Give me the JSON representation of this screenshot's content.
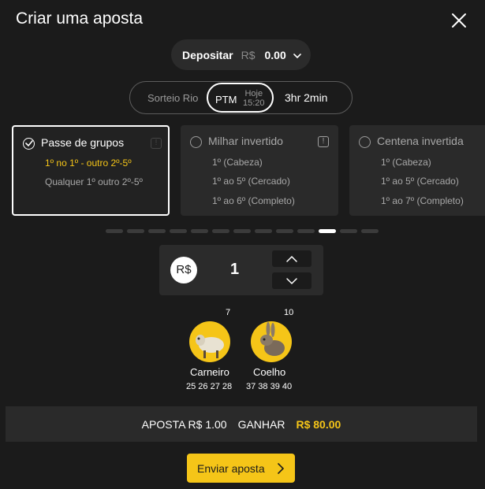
{
  "header": {
    "title": "Criar uma aposta"
  },
  "deposit": {
    "label": "Depositar",
    "currency": "R$",
    "amount": "0.00"
  },
  "draw_selector": {
    "option1": "Sorteio Rio",
    "selected_label": "PTM",
    "selected_sub_top": "Hoje",
    "selected_sub_bottom": "15:20",
    "countdown": "3hr 2min"
  },
  "cards": [
    {
      "title": "Passe de grupos",
      "options": [
        "1º no 1º - outro 2º-5º",
        "Qualquer 1º outro 2º-5º"
      ]
    },
    {
      "title": "Milhar invertido",
      "options": [
        "1º (Cabeza)",
        "1º ao 5º (Cercado)",
        "1º ao 6º (Completo)"
      ]
    },
    {
      "title": "Centena invertida",
      "options": [
        "1º (Cabeza)",
        "1º ao 5º (Cercado)",
        "1º ao 7º (Completo)"
      ]
    }
  ],
  "pagination": {
    "total": 13,
    "active_index": 10
  },
  "amount": {
    "currency_symbol": "R$",
    "value": "1"
  },
  "animals": [
    {
      "number": "7",
      "name": "Carneiro",
      "numbers": "25 26 27 28"
    },
    {
      "number": "10",
      "name": "Coelho",
      "numbers": "37 38 39 40"
    }
  ],
  "summary": {
    "bet_label": "APOSTA R$ 1.00",
    "win_label": "GANHAR",
    "win_value": "R$ 80.00"
  },
  "submit": {
    "label": "Enviar aposta"
  },
  "colors": {
    "accent": "#f5c518",
    "background": "#1b1b1b",
    "panel": "#2a2a2a"
  }
}
